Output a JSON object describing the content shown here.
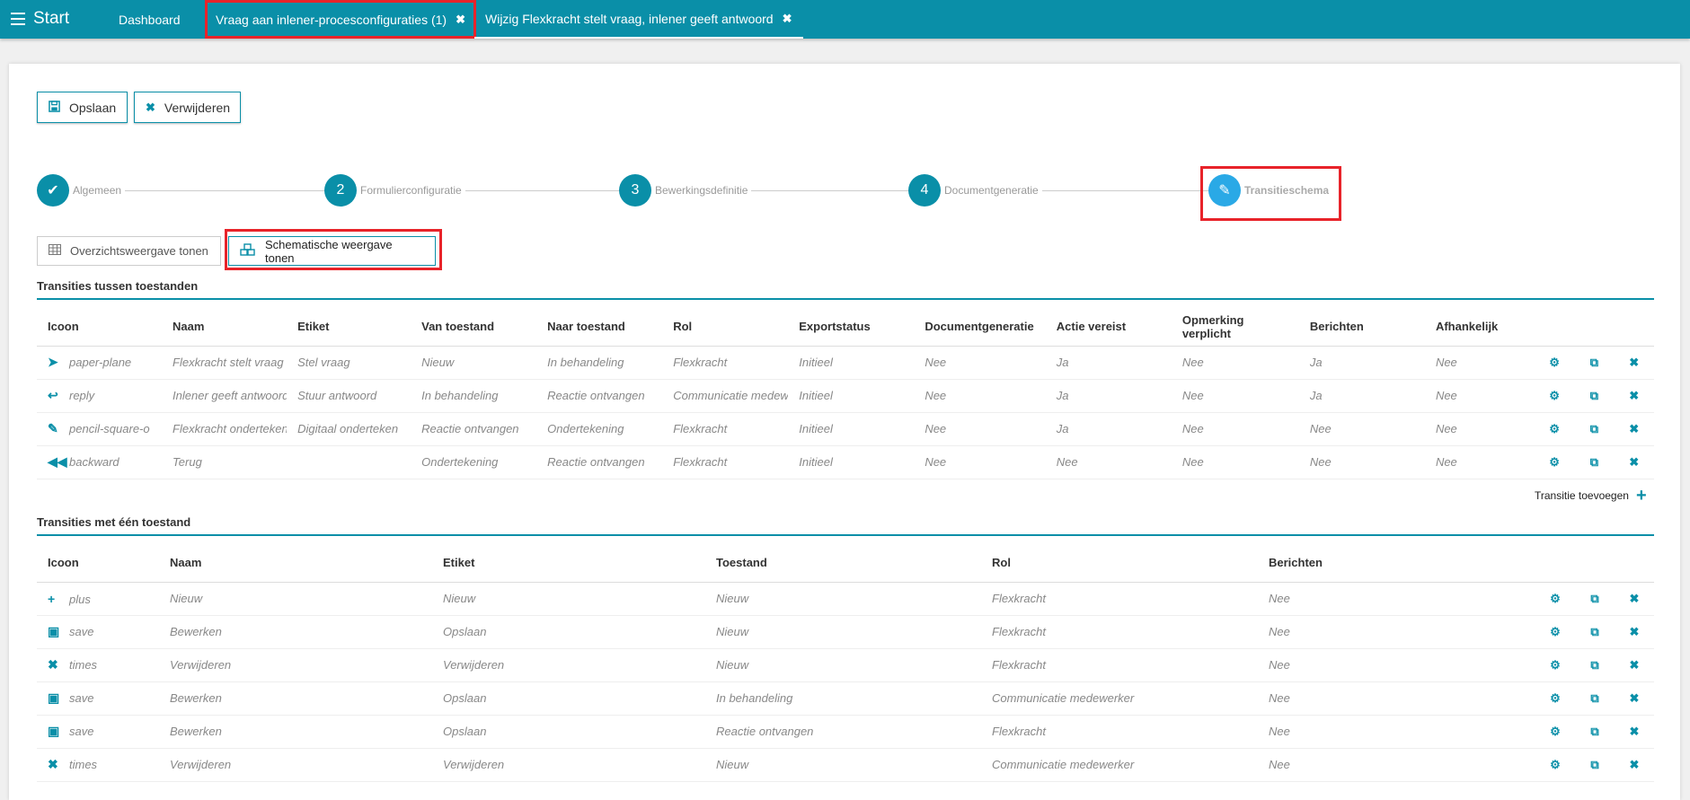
{
  "topbar": {
    "menu_label": "Start",
    "tabs": [
      {
        "label": "Dashboard"
      },
      {
        "label": "Vraag aan inlener-procesconfiguraties (1)"
      },
      {
        "label": "Wijzig Flexkracht stelt vraag, inlener geeft antwoord"
      }
    ]
  },
  "toolbar": {
    "save_label": "Opslaan",
    "delete_label": "Verwijderen"
  },
  "steps": [
    {
      "number": "✔",
      "label": "Algemeen"
    },
    {
      "number": "2",
      "label": "Formulierconfiguratie"
    },
    {
      "number": "3",
      "label": "Bewerkingsdefinitie"
    },
    {
      "number": "4",
      "label": "Documentgeneratie"
    },
    {
      "number": "✎",
      "label": "Transitieschema"
    }
  ],
  "view_toggle": {
    "overview_label": "Overzichtsweergave tonen",
    "schema_label": "Schematische weergave tonen"
  },
  "transitions": {
    "title": "Transities tussen toestanden",
    "headers": [
      "Icoon",
      "Naam",
      "Etiket",
      "Van toestand",
      "Naar toestand",
      "Rol",
      "Exportstatus",
      "Documentgeneratie",
      "Actie vereist",
      "Opmerking verplicht",
      "Berichten",
      "Afhankelijk"
    ],
    "rows": [
      [
        "paper-plane",
        "Flexkracht stelt vraag",
        "Stel vraag",
        "Nieuw",
        "In behandeling",
        "Flexkracht",
        "Initieel",
        "Nee",
        "Ja",
        "Nee",
        "Ja",
        "Nee"
      ],
      [
        "reply",
        "Inlener geeft antwoord",
        "Stuur antwoord",
        "In behandeling",
        "Reactie ontvangen",
        "Communicatie medewerker",
        "Initieel",
        "Nee",
        "Ja",
        "Nee",
        "Ja",
        "Nee"
      ],
      [
        "pencil-square-o",
        "Flexkracht ondertekent",
        "Digitaal onderteken",
        "Reactie ontvangen",
        "Ondertekening",
        "Flexkracht",
        "Initieel",
        "Nee",
        "Ja",
        "Nee",
        "Nee",
        "Nee"
      ],
      [
        "backward",
        "Terug",
        "",
        "Ondertekening",
        "Reactie ontvangen",
        "Flexkracht",
        "Initieel",
        "Nee",
        "Nee",
        "Nee",
        "Nee",
        "Nee"
      ]
    ],
    "add_label": "Transitie toevoegen"
  },
  "single_state": {
    "title": "Transities met één toestand",
    "headers": [
      "Icoon",
      "Naam",
      "Etiket",
      "Toestand",
      "Rol",
      "Berichten"
    ],
    "rows": [
      [
        "plus",
        "Nieuw",
        "Nieuw",
        "Nieuw",
        "Flexkracht",
        "Nee"
      ],
      [
        "save",
        "Bewerken",
        "Opslaan",
        "Nieuw",
        "Flexkracht",
        "Nee"
      ],
      [
        "times",
        "Verwijderen",
        "Verwijderen",
        "Nieuw",
        "Flexkracht",
        "Nee"
      ],
      [
        "save",
        "Bewerken",
        "Opslaan",
        "In behandeling",
        "Communicatie medewerker",
        "Nee"
      ],
      [
        "save",
        "Bewerken",
        "Opslaan",
        "Reactie ontvangen",
        "Flexkracht",
        "Nee"
      ],
      [
        "times",
        "Verwijderen",
        "Verwijderen",
        "Nieuw",
        "Communicatie medewerker",
        "Nee"
      ]
    ]
  },
  "colors": {
    "accent": "#0a8fa8",
    "highlight": "#e8232a",
    "active_step": "#2aa9e6"
  }
}
